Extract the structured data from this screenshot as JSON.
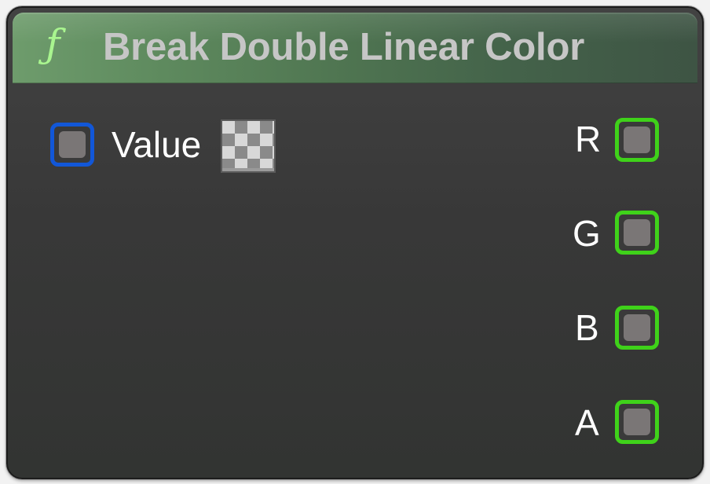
{
  "node": {
    "icon": "function-icon",
    "icon_glyph": "ƒ",
    "title": "Break Double Linear Color",
    "header_color": "#5e8a5e"
  },
  "inputs": [
    {
      "label": "Value",
      "pin_color": "#1257d8",
      "default_value": "checkerboard-swatch"
    }
  ],
  "outputs": [
    {
      "label": "R",
      "pin_color": "#3fd21a"
    },
    {
      "label": "G",
      "pin_color": "#3fd21a"
    },
    {
      "label": "B",
      "pin_color": "#3fd21a"
    },
    {
      "label": "A",
      "pin_color": "#3fd21a"
    }
  ]
}
